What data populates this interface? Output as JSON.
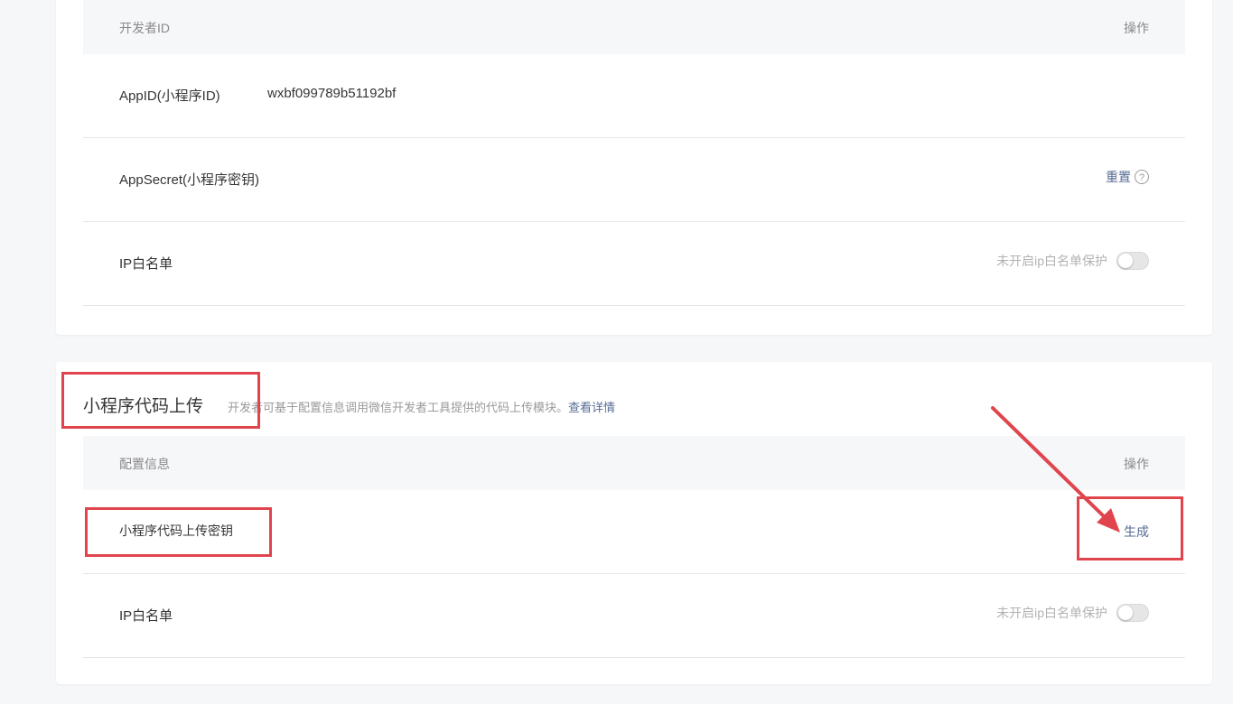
{
  "developer_section": {
    "header": {
      "col1": "开发者ID",
      "col2": "操作"
    },
    "rows": [
      {
        "label": "AppID(小程序ID)",
        "value": "wxbf099789b51192bf"
      },
      {
        "label": "AppSecret(小程序密钥)",
        "action": "重置"
      },
      {
        "label": "IP白名单",
        "status": "未开启ip白名单保护",
        "toggle_on": false
      }
    ]
  },
  "upload_section": {
    "title": "小程序代码上传",
    "description": "开发者可基于配置信息调用微信开发者工具提供的代码上传模块。",
    "detail_link": "查看详情",
    "header": {
      "col1": "配置信息",
      "col2": "操作"
    },
    "rows": [
      {
        "label": "小程序代码上传密钥",
        "action": "生成"
      },
      {
        "label": "IP白名单",
        "status": "未开启ip白名单保护",
        "toggle_on": false
      }
    ]
  },
  "colors": {
    "link": "#576b95",
    "annotation": "#e0454d",
    "background": "#f6f7f9"
  },
  "icons": [
    "help-circle-icon",
    "toggle-switch"
  ]
}
